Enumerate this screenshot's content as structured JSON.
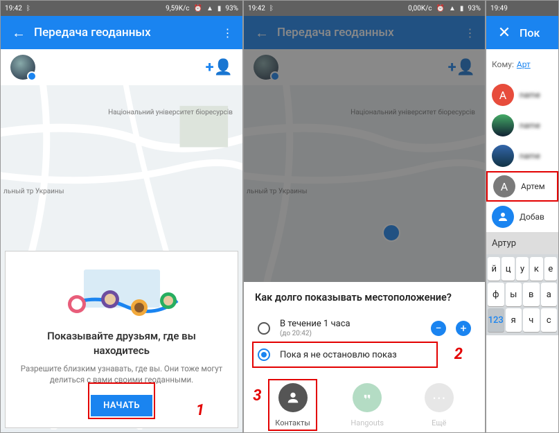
{
  "s1": {
    "status": {
      "time": "19:42",
      "speed": "9,59K/c",
      "battery": "93%"
    },
    "title": "Передача геоданных",
    "map": {
      "label1": "Національний\nуніверситет\nбіоресурсів",
      "label2": "льный\nтр Украины"
    },
    "card": {
      "heading": "Показывайте друзьям, где вы находитесь",
      "body": "Разрешите близким узнавать, где вы. Они тоже могут делиться с вами своими геоданными.",
      "button": "НАЧАТЬ"
    },
    "annot": "1"
  },
  "s2": {
    "status": {
      "time": "19:42",
      "speed": "0,00K/c",
      "battery": "93%"
    },
    "title": "Передача геоданных",
    "sheet": {
      "question": "Как долго показывать местоположение?",
      "opt1": "В течение 1 часа",
      "opt1_sub": "(до 20:42)",
      "opt2": "Пока я не остановлю показ",
      "share": {
        "contacts": "Контакты",
        "hangouts": "Hangouts",
        "more": "Ещё"
      }
    },
    "annot_radio": "2",
    "annot_contacts": "3"
  },
  "s3": {
    "status": {
      "time": "19:49"
    },
    "title": "Пок",
    "recipient_label": "Кому:",
    "recipient_value": "Арт",
    "contacts": [
      {
        "name": "——",
        "letter": "A",
        "color": "#e74c3c"
      },
      {
        "name": "——",
        "img": true
      },
      {
        "name": "——",
        "img": true
      },
      {
        "name": "Артем",
        "letter": "A",
        "color": "#7a7a7a",
        "selected": true
      },
      {
        "name": "Добав",
        "icon": "add",
        "color": "#1a84f0"
      }
    ],
    "suggestion": "Артур",
    "keyboard": {
      "row1": [
        "й",
        "ц",
        "у",
        "к",
        "е"
      ],
      "row2": [
        "ф",
        "ы",
        "в",
        "а"
      ],
      "row3": [
        "123",
        "я",
        "ч",
        "с"
      ]
    }
  }
}
